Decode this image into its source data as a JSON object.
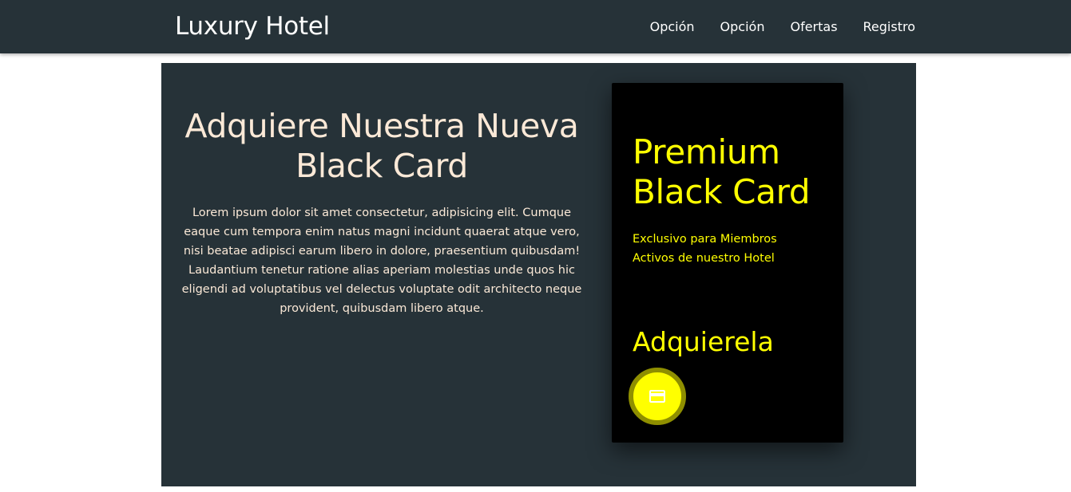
{
  "header": {
    "brand": "Luxury Hotel",
    "nav": [
      {
        "label": "Opción"
      },
      {
        "label": "Opción"
      },
      {
        "label": "Ofertas"
      },
      {
        "label": "Registro"
      }
    ]
  },
  "hero": {
    "title": "Adquiere Nuestra Nueva Black Card",
    "body": "Lorem ipsum dolor sit amet consectetur, adipisicing elit. Cumque eaque cum tempora enim natus magni incidunt quaerat atque vero, nisi beatae adipisci earum libero in dolore, praesentium quibusdam! Laudantium tenetur ratione alias aperiam molestias unde quos hic eligendi ad voluptatibus vel delectus voluptate odit architecto neque provident, quibusdam libero atque."
  },
  "card": {
    "title": "Premium Black Card",
    "subtitle": "Exclusivo para Miembros Activos de nuestro Hotel",
    "cta": "Adquierela",
    "fab_icon": "credit-card-icon"
  },
  "colors": {
    "navbar_bg": "#263238",
    "hero_bg": "#263238",
    "hero_text": "#fbe9d7",
    "card_bg": "#000000",
    "card_accent": "#ffff00"
  }
}
